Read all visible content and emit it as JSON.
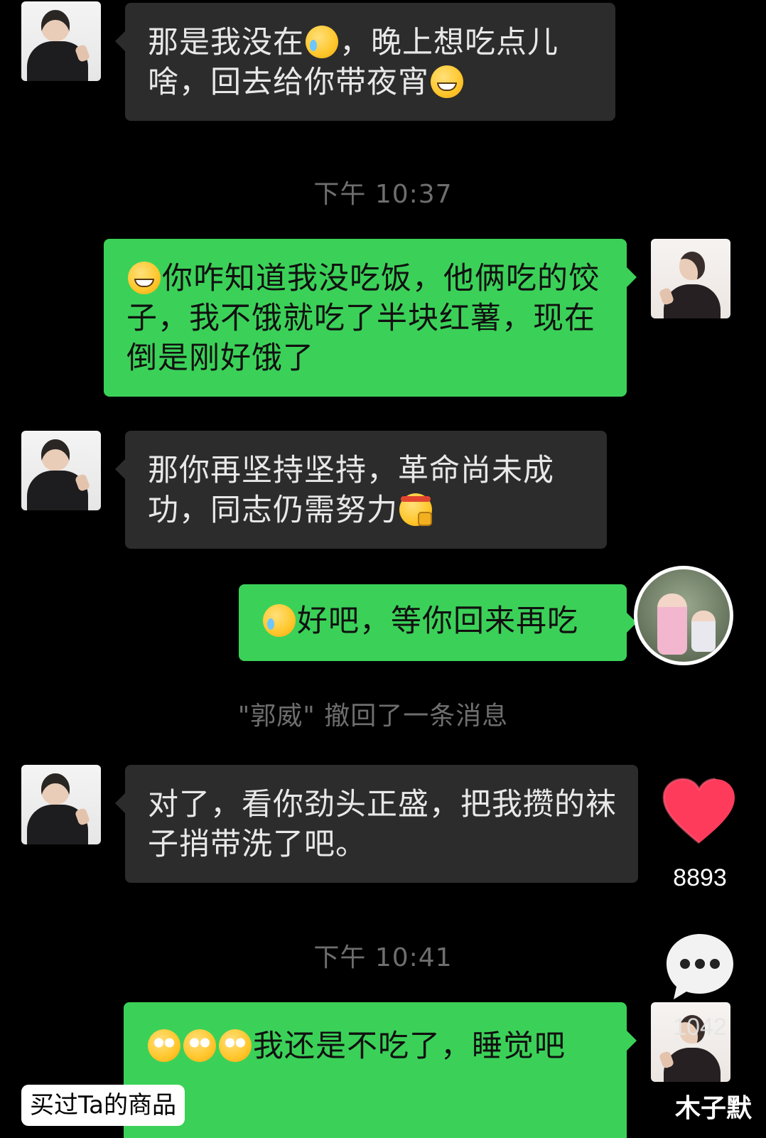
{
  "messages": [
    {
      "side": "left",
      "text_a": "那是我没在",
      "emoji_a": "cry",
      "text_b": "，晚上想吃点儿啥，回去给你带夜宵",
      "emoji_b": "grin"
    },
    {
      "side": "right",
      "emoji_a": "grin",
      "text_a": "你咋知道我没吃饭，他俩吃的饺子，我不饿就吃了半块红薯，现在倒是刚好饿了"
    },
    {
      "side": "left",
      "text_a": "那你再坚持坚持，革命尚未成功，同志仍需努力",
      "emoji_a": "fight"
    },
    {
      "side": "right",
      "emoji_a": "cry",
      "text_a": "好吧，等你回来再吃"
    },
    {
      "side": "left",
      "text_a": "对了，看你劲头正盛，把我攒的袜子捎带洗了吧。"
    },
    {
      "side": "right",
      "emoji_a": "roll",
      "text_a": "我还是不吃了，睡觉吧"
    }
  ],
  "timestamps": {
    "t1": "下午 10:37",
    "t2": "下午 10:41"
  },
  "system_notice": "\"郭威\" 撤回了一条消息",
  "actions": {
    "like_icon": "heart-icon",
    "like_count": "8893",
    "comment_icon": "comment-icon",
    "comment_count": "1042"
  },
  "buy_tag": "买过Ta的商品",
  "watermark": "木子默",
  "colors": {
    "green_bubble": "#3bd158",
    "dark_bubble": "#2c2c2c",
    "background": "#000000",
    "heart": "#ff3b5c"
  }
}
